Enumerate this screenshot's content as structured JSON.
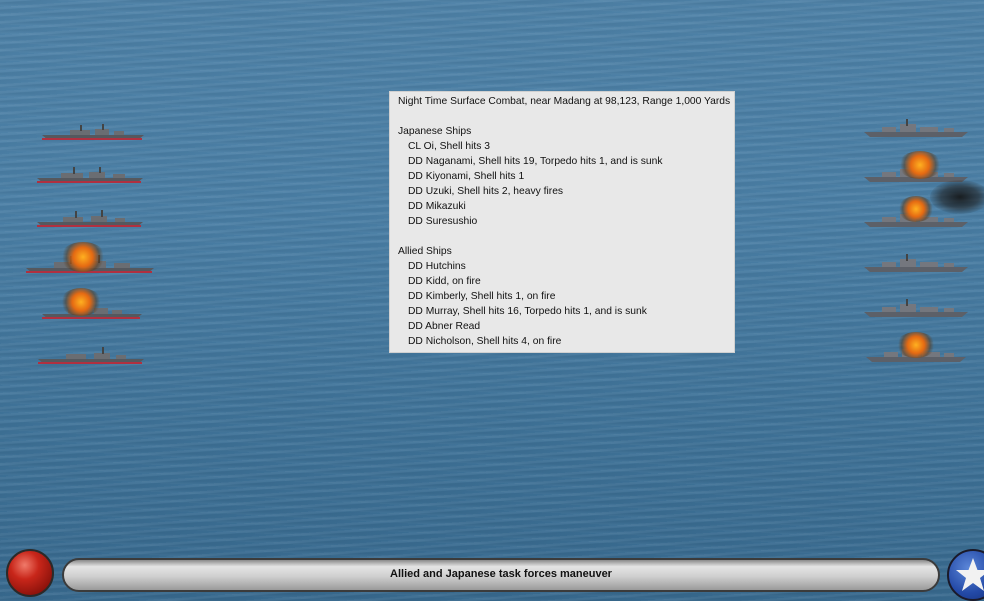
{
  "report": {
    "header": "Night Time Surface Combat, near Madang at 98,123, Range 1,000 Yards",
    "japanese_title": "Japanese Ships",
    "japanese_ships": [
      "CL Oi, Shell hits 3",
      "DD Naganami, Shell hits 19, Torpedo hits 1, and is sunk",
      "DD Kiyonami, Shell hits 1",
      "DD Uzuki, Shell hits 2,  heavy fires",
      "DD Mikazuki",
      "DD Suresushio"
    ],
    "allied_title": "Allied Ships",
    "allied_ships": [
      "DD Hutchins",
      "DD Kidd,  on fire",
      "DD Kimberly, Shell hits 1,  on fire",
      "DD Murray, Shell hits 16, Torpedo hits 1, and is sunk",
      "DD Abner Read",
      "DD Nicholson, Shell hits 4,  on fire"
    ]
  },
  "status_bar": {
    "message": "Allied and Japanese task forces maneuver"
  },
  "icons": {
    "left_button": "red-button-icon",
    "right_emblem": "us-star-emblem-icon"
  },
  "colors": {
    "sea": "#4a7fa6",
    "panel": "#e8e8e8",
    "fire": "#e56a12"
  }
}
